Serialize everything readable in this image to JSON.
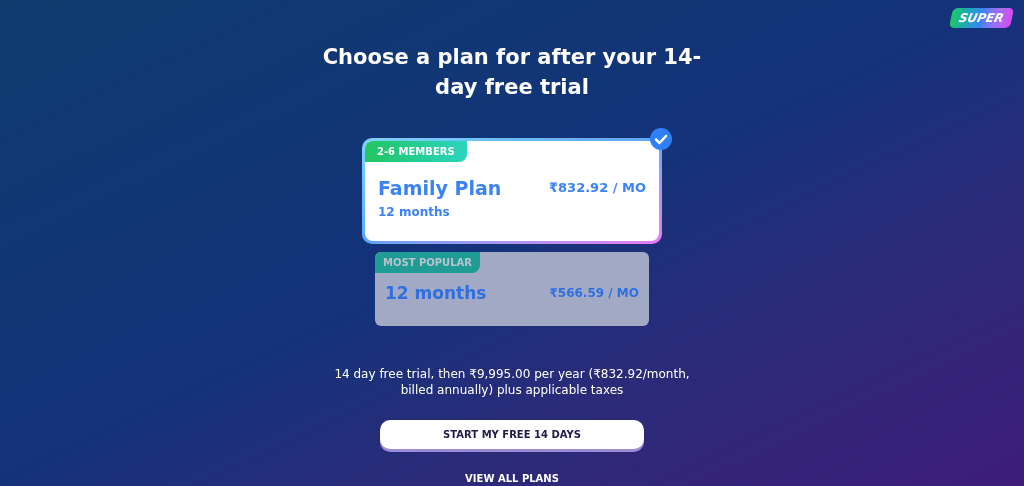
{
  "logo": "SUPER",
  "heading": "Choose a plan for after your 14-day free trial",
  "plans": [
    {
      "badge": "2-6 MEMBERS",
      "title": "Family Plan",
      "subtitle": "12 months",
      "price": "₹832.92 / MO",
      "selected": true
    },
    {
      "badge": "MOST POPULAR",
      "title": "12 months",
      "price": "₹566.59 / MO",
      "selected": false
    }
  ],
  "terms": "14 day free trial, then ₹9,995.00 per year (₹832.92/month, billed annually) plus applicable taxes",
  "start_button": "START MY FREE 14 DAYS",
  "view_all_link": "VIEW ALL PLANS"
}
